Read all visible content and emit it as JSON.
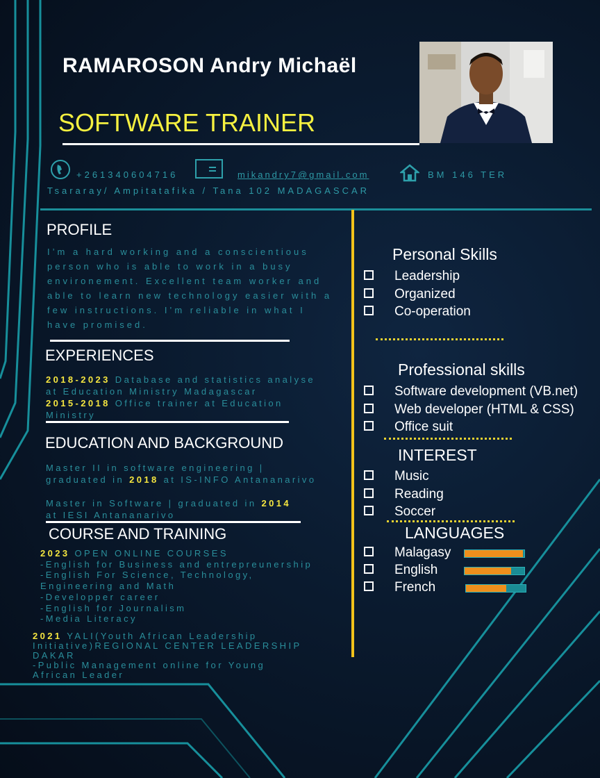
{
  "name": "RAMAROSON  Andry Michaël",
  "title": "SOFTWARE TRAINER",
  "contact": {
    "phone": "+261340604716",
    "email": "mikandry7@gmail.com",
    "address_line1": "BM 146 TER",
    "address_line2": "Tsararay/ Ampitatafika / Tana 102 MADAGASCAR"
  },
  "profile": {
    "heading": "PROFILE",
    "lines": [
      "I’m a hard working and a conscientious",
      "person who is able to work in a busy",
      "environement. Excellent team worker and",
      "able to learn new technology easier with a",
      "few instructions. I’m reliable in what I",
      "have promised."
    ]
  },
  "experiences": {
    "heading": "EXPERIENCES",
    "items": [
      {
        "year": "2018-2023",
        "line1": " Database and statistics analyse",
        "line2": "at Education Ministry Madagascar"
      },
      {
        "year": "2015-2018",
        "line1": "  Office trainer at Education",
        "line2": "Ministry"
      }
    ]
  },
  "education": {
    "heading": "EDUCATION AND BACKGROUND",
    "items": [
      {
        "line1": "Master II in software engineering |",
        "line2_pre": "graduated in ",
        "year": "2018",
        "line2_post": " at IS-INFO Antananarivo"
      },
      {
        "line1_pre": "Master in Software | graduated in ",
        "year": "2014",
        "line2": "at IESI Antananarivo"
      }
    ]
  },
  "courses": {
    "heading": "COURSE AND TRAINING",
    "block1_year": "2023",
    "block1_title": " OPEN ONLINE COURSES",
    "block1_lines": [
      "-English for Business and entrepreunership",
      "-English For Science, Technology,",
      "Engineering and Math",
      "-Developper career",
      "-English for Journalism",
      "-Media Literacy"
    ],
    "block2_year": "2021",
    "block2_title": " YALI(Youth African Leadership",
    "block2_lines": [
      "Initiative)REGIONAL CENTER LEADERSHIP",
      "DAKAR",
      " -Public Management online for Young",
      "African Leader"
    ]
  },
  "personal_skills": {
    "heading": "Personal Skills",
    "items": [
      "Leadership",
      "Organized",
      "Co-operation"
    ]
  },
  "professional_skills": {
    "heading": "Professional skills",
    "items": [
      "Software development (VB.net)",
      "Web developer (HTML & CSS)",
      "Office suit"
    ]
  },
  "interest": {
    "heading": "INTEREST",
    "items": [
      "Music",
      "Reading",
      "Soccer"
    ]
  },
  "languages": {
    "heading": "LANGUAGES",
    "items": [
      {
        "name": "Malagasy",
        "level": 0.98
      },
      {
        "name": "English",
        "level": 0.78
      },
      {
        "name": "French",
        "level": 0.68
      }
    ]
  },
  "colors": {
    "accent_yellow": "#f5f040",
    "teal": "#1b8e99",
    "divider": "#f2c21a",
    "bar_fill": "#ee8f1c"
  }
}
